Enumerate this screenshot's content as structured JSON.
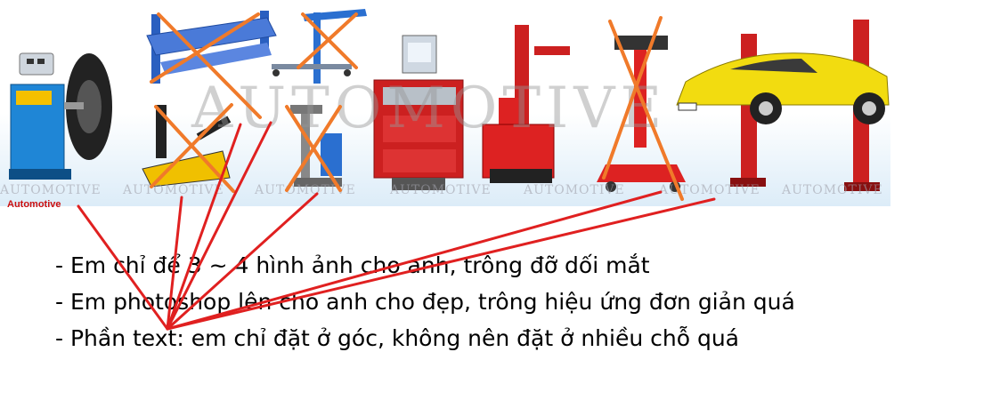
{
  "banner": {
    "watermark": "AUTOMOTIVE",
    "watermark_repeat": [
      "AUTOMOTIVE",
      "AUTOMOTIVE",
      "AUTOMOTIVE",
      "AUTOMOTIVE",
      "AUTOMOTIVE",
      "AUTOMOTIVE",
      "AUTOMOTIVE",
      "AUTOMOTIVE"
    ],
    "brand_label": "Automotive"
  },
  "notes": [
    "- Em chỉ để 3 ~ 4 hình ảnh cho anh, trông đỡ dối mắt",
    "- Em photoshop lên cho anh cho đẹp, trông hiệu ứng đơn giản quá",
    "- Phần text: em chỉ đặt ở góc, không nên đặt ở nhiều chỗ quá"
  ],
  "colors": {
    "annotation": "#e02020",
    "cross": "#f07a2a",
    "equipment_red": "#d42020",
    "equipment_blue": "#2080c8",
    "car_yellow": "#f2dc10"
  },
  "icons": [
    "wheel-balancer-icon",
    "four-post-lift-icon",
    "engine-crane-icon",
    "floor-jack-icon",
    "transmission-jack-icon",
    "tool-cabinet-icon",
    "tire-changer-icon",
    "transmission-jack-red-icon",
    "two-post-lift-car-icon"
  ]
}
